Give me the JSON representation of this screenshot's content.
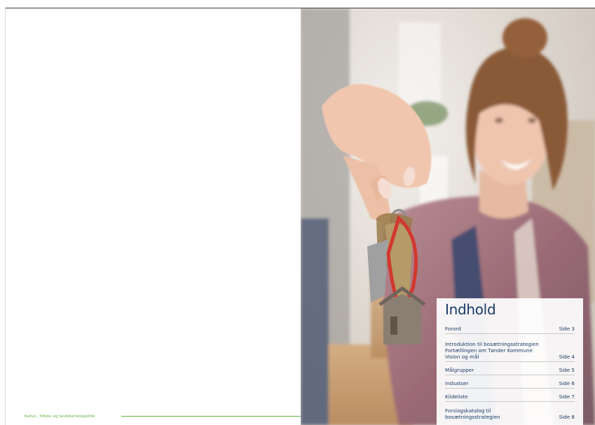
{
  "footer": {
    "text": "Kultur-, fritids- og landdistriktspolitik"
  },
  "toc": {
    "title": "Indhold",
    "items": [
      {
        "label": "Forord",
        "page": "Side 3"
      },
      {
        "label": "Introduktion til bosætningsstrategien\nFortællingen om Tønder Kommune\nVision og mål",
        "page": "Side 4"
      },
      {
        "label": "Målgrupper",
        "page": "Side 5"
      },
      {
        "label": "Indsatser",
        "page": "Side 6"
      },
      {
        "label": "Kildeliste",
        "page": "Side 7"
      },
      {
        "label": "Forslagskatalog til\nbosætningsstrategien",
        "page": "Side 8"
      }
    ]
  },
  "photo": {
    "subject": "woman holding house keys"
  },
  "colors": {
    "accent_green": "#5db33c",
    "heading_blue": "#1a3a66"
  }
}
